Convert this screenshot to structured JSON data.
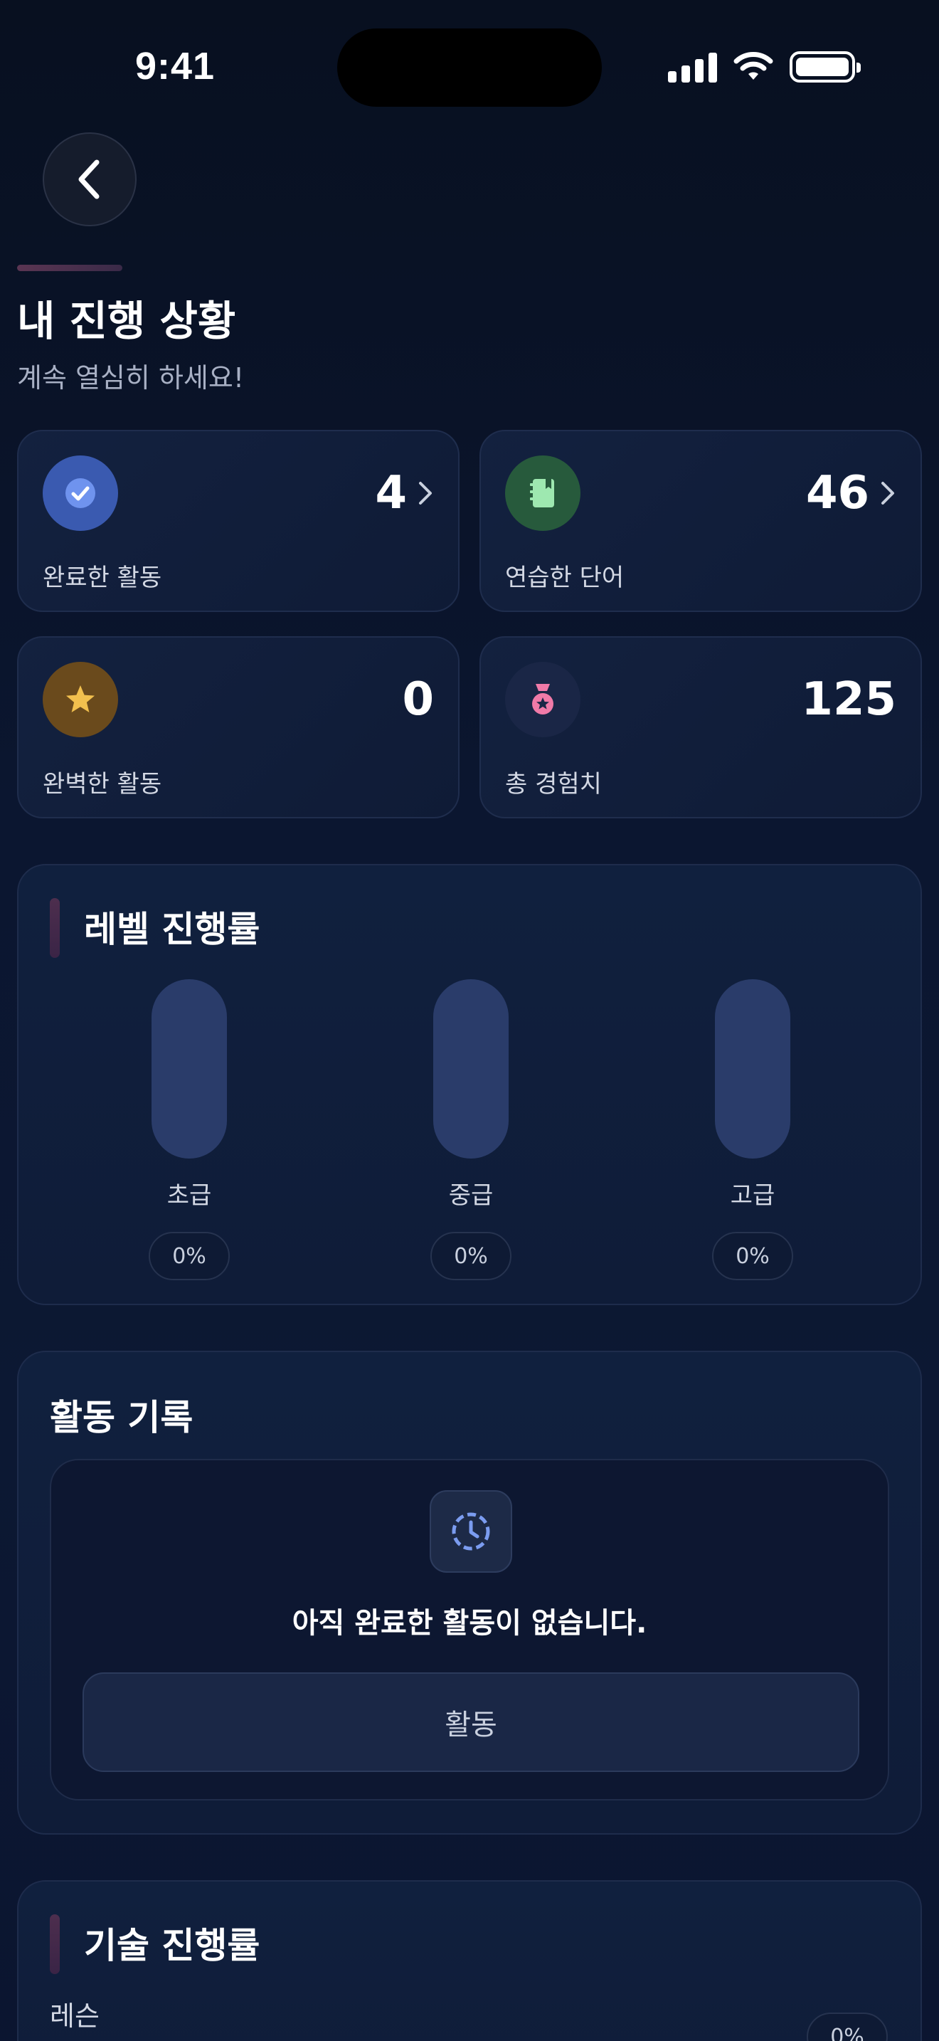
{
  "status_bar": {
    "time": "9:41"
  },
  "header": {
    "title": "내 진행 상황",
    "subtitle": "계속 열심히 하세요!"
  },
  "stats": [
    {
      "label": "완료한 활동",
      "value": "4",
      "icon": "check-circle-icon",
      "icon_bg": "#3a5ab0",
      "icon_color": "#e8f0ff",
      "has_chevron": true
    },
    {
      "label": "연습한 단어",
      "value": "46",
      "icon": "notebook-icon",
      "icon_bg": "#275a3c",
      "icon_color": "#9ee8b0",
      "has_chevron": true
    },
    {
      "label": "완벽한 활동",
      "value": "0",
      "icon": "star-icon",
      "icon_bg": "#6a4a1c",
      "icon_color": "#f2c04e",
      "has_chevron": false
    },
    {
      "label": "총 경험치",
      "value": "125",
      "icon": "medal-icon",
      "icon_bg": "#1a2646",
      "icon_color": "#f07aa8",
      "has_chevron": false
    }
  ],
  "level_progress": {
    "title": "레벨 진행률",
    "levels": [
      {
        "name": "초급",
        "percent_label": "0%",
        "progress": 0
      },
      {
        "name": "중급",
        "percent_label": "0%",
        "progress": 0
      },
      {
        "name": "고급",
        "percent_label": "0%",
        "progress": 0
      }
    ]
  },
  "activity_log": {
    "title": "활동 기록",
    "empty_message": "아직 완료한 활동이 없습니다.",
    "button_label": "활동",
    "icon": "clock-icon"
  },
  "skill_progress": {
    "title": "기술 진행률",
    "items": [
      {
        "label": "레슨",
        "percent_label": "0%",
        "progress": 0
      }
    ]
  },
  "colors": {
    "background": "#0a1124",
    "card": "#13213f",
    "accent": "#6b8ef0",
    "section_accent": "#4d2e4e"
  }
}
